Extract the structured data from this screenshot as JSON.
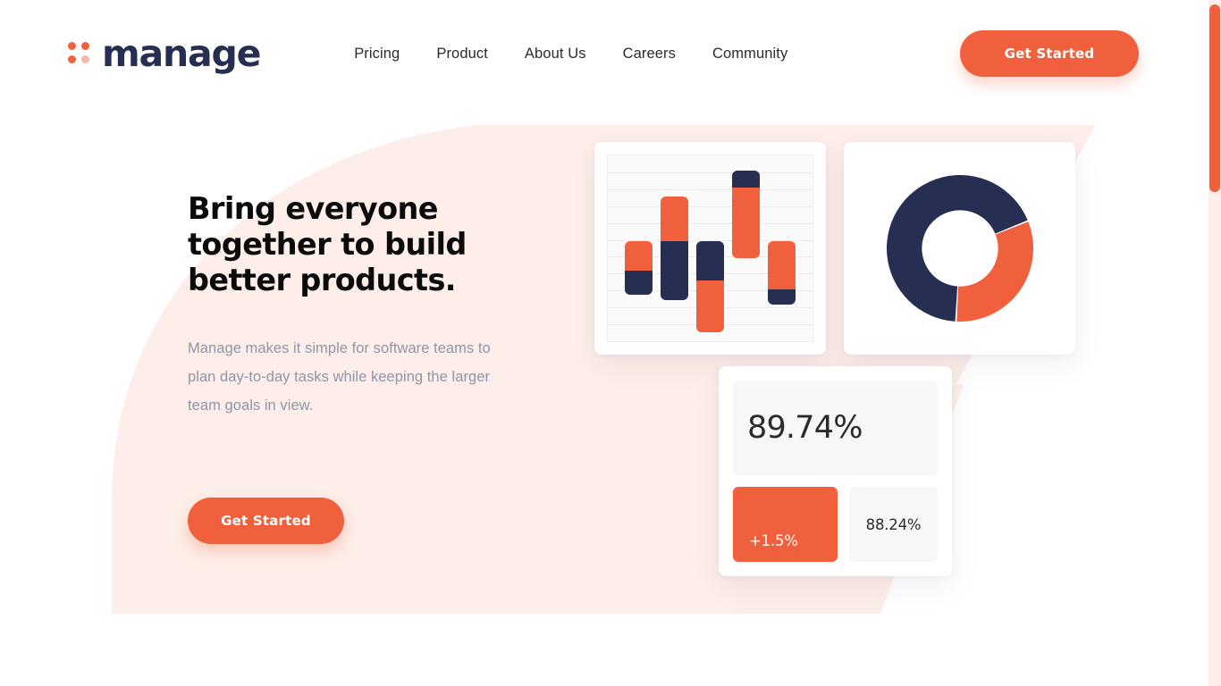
{
  "brand": {
    "name": "manage",
    "mark_dots": [
      "solid",
      "solid",
      "solid",
      "faded"
    ],
    "accent_color": "#f1603c",
    "navy_color": "#262E51"
  },
  "nav": {
    "items": [
      {
        "label": "Pricing"
      },
      {
        "label": "Product"
      },
      {
        "label": "About Us"
      },
      {
        "label": "Careers"
      },
      {
        "label": "Community"
      }
    ],
    "cta_label": "Get Started"
  },
  "hero": {
    "title_line1": "Bring everyone",
    "title_line2": "together to build",
    "title_line3": "better products.",
    "subtitle_line1": "Manage makes it simple for software teams",
    "subtitle_line2": "to plan day-to-day tasks while keeping the",
    "subtitle_line3": "larger team goals in view.",
    "cta_label": "Get Started",
    "background_shape_color": "#fdeee9"
  },
  "illustration": {
    "stats": {
      "headline_value": "89.74%",
      "delta_value": "+1.5%",
      "comparison_value": "88.24%"
    }
  },
  "scrollbar": {
    "thumb_color": "#f1603c",
    "track_color": "#fdeeea"
  },
  "chart_data": [
    {
      "type": "bar",
      "title": "",
      "xlabel": "",
      "ylabel": "",
      "grid": true,
      "gridlines": 11,
      "ylim": [
        0,
        100
      ],
      "categories": [
        "1",
        "2",
        "3",
        "4",
        "5"
      ],
      "note": "floating stacked range bars, orange over navy",
      "bars": [
        {
          "category": "1",
          "top": 54,
          "bottom": 25,
          "split": 38,
          "orange_first": true
        },
        {
          "category": "2",
          "top": 78,
          "bottom": 22,
          "split": 54,
          "orange_first": true
        },
        {
          "category": "3",
          "top": 54,
          "bottom": 5,
          "split": 33,
          "orange_first": false
        },
        {
          "category": "4",
          "top": 92,
          "bottom": 45,
          "split": 83,
          "orange_first": false
        },
        {
          "category": "5",
          "top": 54,
          "bottom": 20,
          "split": 28,
          "orange_first": true
        }
      ],
      "series": [
        {
          "name": "Orange",
          "values": [
            16,
            24,
            28,
            38,
            26
          ]
        },
        {
          "name": "Navy",
          "values": [
            13,
            32,
            21,
            9,
            8
          ]
        }
      ]
    },
    {
      "type": "pie",
      "subtype": "donut",
      "title": "",
      "labels": [
        "Orange segment",
        "Navy segment"
      ],
      "values": [
        32,
        68
      ],
      "colors": [
        "#f1603c",
        "#262E51"
      ],
      "start_angle_deg": -22,
      "inner_radius_ratio": 0.52,
      "legend": "none"
    }
  ]
}
